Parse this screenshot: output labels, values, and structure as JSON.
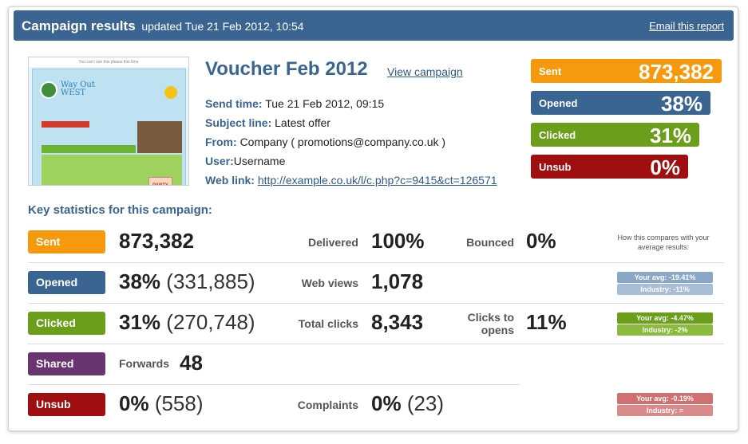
{
  "header": {
    "title": "Campaign results",
    "updated": "updated Tue 21 Feb 2012, 10:54",
    "email_link": "Email this report"
  },
  "thumbnail": {
    "top_text": "You can't see this please this time",
    "logo_text_1": "Way Out",
    "logo_text_2": "WEST",
    "party_text": "PARTY"
  },
  "campaign": {
    "name": "Voucher Feb 2012",
    "view_link": "View campaign",
    "send_time_label": "Send time:",
    "send_time": "Tue 21 Feb 2012, 09:15",
    "subject_label": "Subject line:",
    "subject": "Latest offer",
    "from_label": "From:",
    "from": "Company ( promotions@company.co.uk )",
    "user_label": "User:",
    "user": "Username",
    "weblink_label": "Web link:",
    "weblink": "http://example.co.uk/l/c.php?c=9415&ct=126571"
  },
  "summary": {
    "sent_label": "Sent",
    "sent_value": "873,382",
    "opened_label": "Opened",
    "opened_value": "38%",
    "clicked_label": "Clicked",
    "clicked_value": "31%",
    "unsub_label": "Unsub",
    "unsub_value": "0%"
  },
  "stats": {
    "title": "Key statistics for this campaign:",
    "compare_note": "How this compares with your average results:",
    "rows": {
      "sent": {
        "tag": "Sent",
        "value": "873,382",
        "delivered_label": "Delivered",
        "delivered": "100%",
        "bounced_label": "Bounced",
        "bounced": "0%"
      },
      "opened": {
        "tag": "Opened",
        "value": "38%",
        "paren": "(331,885)",
        "webviews_label": "Web views",
        "webviews": "1,078",
        "your_avg": "Your avg: -19.41%",
        "industry": "Industry: -11%"
      },
      "clicked": {
        "tag": "Clicked",
        "value": "31%",
        "paren": "(270,748)",
        "totalclicks_label": "Total clicks",
        "totalclicks": "8,343",
        "c2o_label_1": "Clicks to",
        "c2o_label_2": "opens",
        "c2o": "11%",
        "your_avg": "Your avg: -4.47%",
        "industry": "Industry: -2%"
      },
      "shared": {
        "tag": "Shared",
        "forwards_label": "Forwards",
        "forwards": "48"
      },
      "unsub": {
        "tag": "Unsub",
        "value": "0%",
        "paren": "(558)",
        "complaints_label": "Complaints",
        "complaints": "0%",
        "complaints_paren": "(23)",
        "your_avg": "Your avg: -0.19%",
        "industry": "Industry: ="
      }
    }
  },
  "colors": {
    "header": "#3a6593",
    "sent": "#f7990c",
    "opened": "#3a6593",
    "clicked": "#6a9e1b",
    "shared": "#6a3470",
    "unsub": "#a00f0f"
  }
}
